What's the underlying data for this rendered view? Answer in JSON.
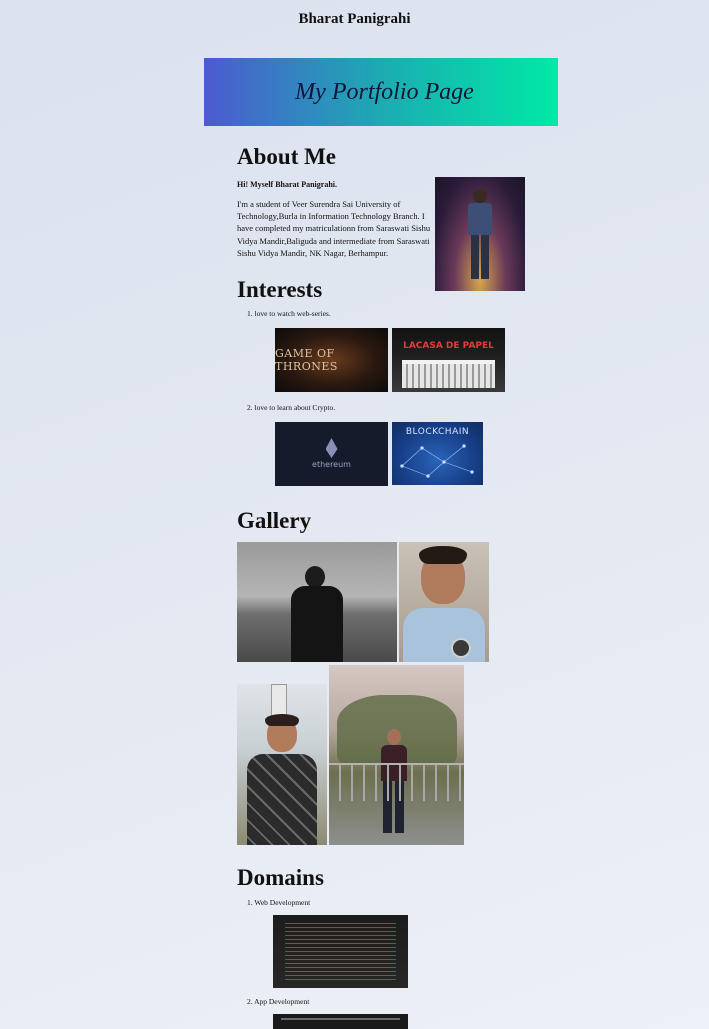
{
  "site_name": "Bharat Panigrahi",
  "banner": {
    "title": "My Portfolio Page"
  },
  "about": {
    "heading": "About Me",
    "intro": "Hi! Myself Bharat Panigrahi.",
    "bio": "I'm a student of Veer Surendra Sai University of Technology,Burla in Information Technology Branch. I have completed my matriculationn from Saraswati Sishu Vidya Mandir,Baliguda and intermediate from Saraswati Sishu Vidya Mandir, NK Nagar, Berhampur."
  },
  "interests": {
    "heading": "Interests",
    "items": [
      {
        "num": "1.",
        "text": "love to watch web-series.",
        "images": [
          "GAME OF THRONES",
          "LACASA DE PAPEL"
        ]
      },
      {
        "num": "2.",
        "text": "love to learn about Crypto.",
        "images": [
          "ethereum",
          "BLOCKCHAIN"
        ]
      }
    ]
  },
  "gallery": {
    "heading": "Gallery"
  },
  "domains": {
    "heading": "Domains",
    "items": [
      {
        "num": "1.",
        "text": "Web Development"
      },
      {
        "num": "2.",
        "text": "App Development"
      }
    ]
  }
}
